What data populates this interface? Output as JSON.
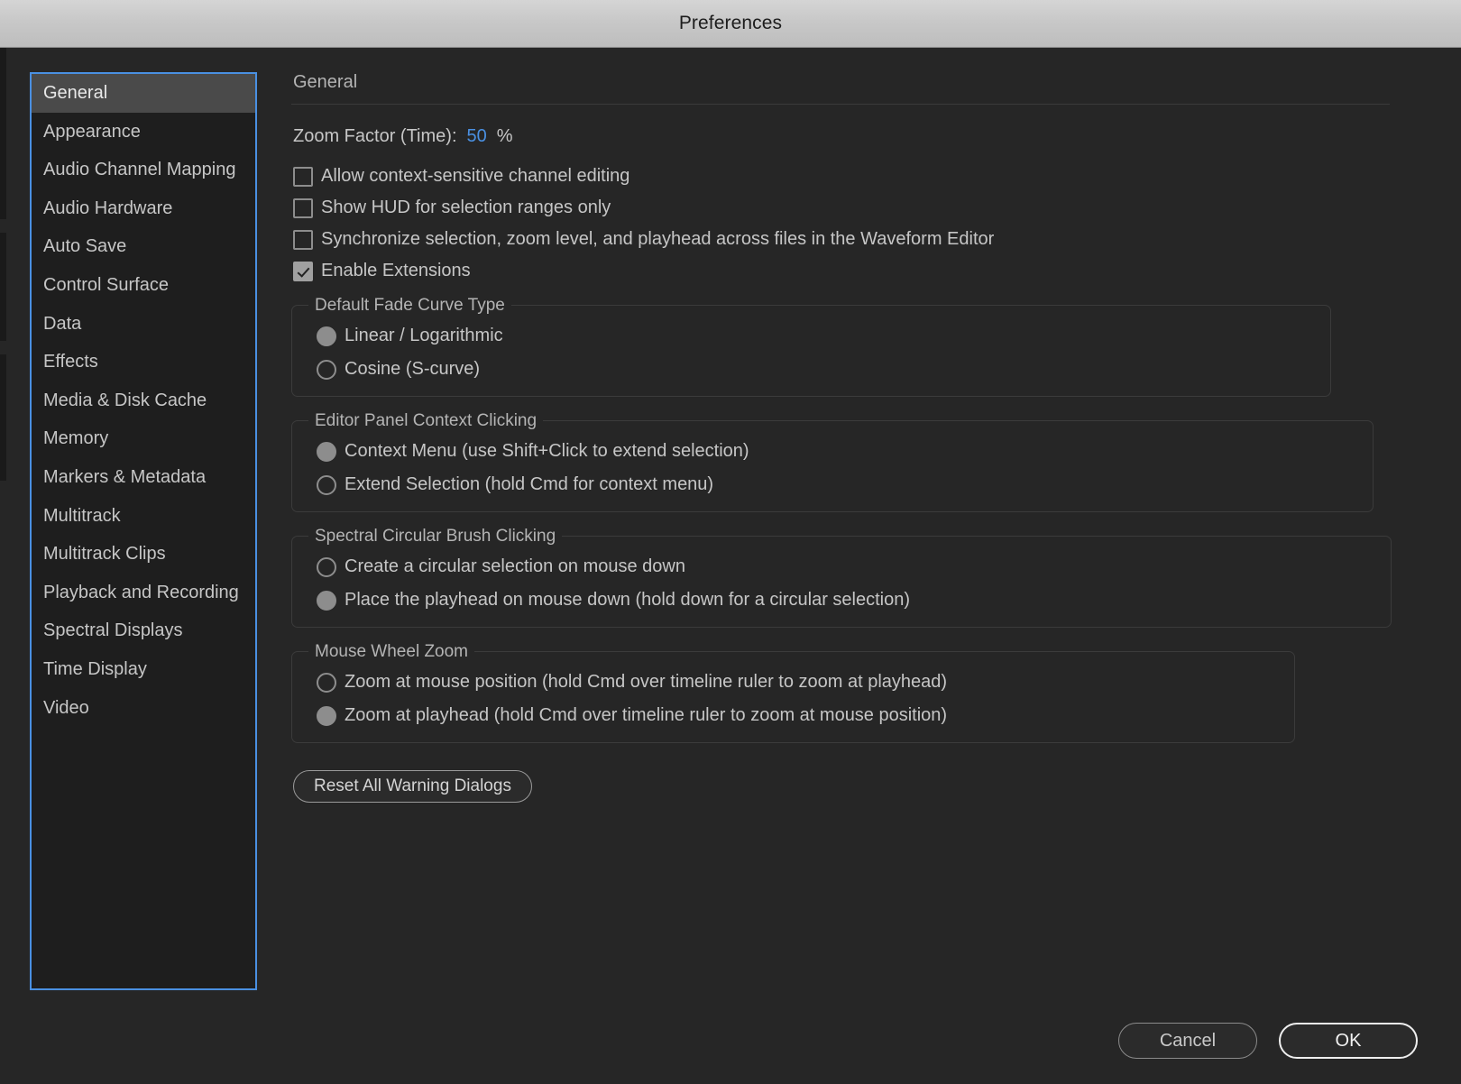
{
  "window": {
    "title": "Preferences"
  },
  "sidebar": {
    "items": [
      {
        "label": "General",
        "selected": true
      },
      {
        "label": "Appearance",
        "selected": false
      },
      {
        "label": "Audio Channel Mapping",
        "selected": false
      },
      {
        "label": "Audio Hardware",
        "selected": false
      },
      {
        "label": "Auto Save",
        "selected": false
      },
      {
        "label": "Control Surface",
        "selected": false
      },
      {
        "label": "Data",
        "selected": false
      },
      {
        "label": "Effects",
        "selected": false
      },
      {
        "label": "Media & Disk Cache",
        "selected": false
      },
      {
        "label": "Memory",
        "selected": false
      },
      {
        "label": "Markers & Metadata",
        "selected": false
      },
      {
        "label": "Multitrack",
        "selected": false
      },
      {
        "label": "Multitrack Clips",
        "selected": false
      },
      {
        "label": "Playback and Recording",
        "selected": false
      },
      {
        "label": "Spectral Displays",
        "selected": false
      },
      {
        "label": "Time Display",
        "selected": false
      },
      {
        "label": "Video",
        "selected": false
      }
    ]
  },
  "main": {
    "heading": "General",
    "zoom_factor": {
      "label": "Zoom Factor (Time):",
      "value": "50",
      "unit": "%"
    },
    "checkboxes": [
      {
        "label": "Allow context-sensitive channel editing",
        "checked": false
      },
      {
        "label": "Show HUD for selection ranges only",
        "checked": false
      },
      {
        "label": "Synchronize selection, zoom level, and playhead across files in the Waveform Editor",
        "checked": false
      },
      {
        "label": "Enable Extensions",
        "checked": true
      }
    ],
    "groups": [
      {
        "legend": "Default Fade Curve Type",
        "options": [
          {
            "label": "Linear / Logarithmic",
            "selected": true
          },
          {
            "label": "Cosine (S-curve)",
            "selected": false
          }
        ]
      },
      {
        "legend": "Editor Panel Context Clicking",
        "options": [
          {
            "label": "Context Menu (use Shift+Click to extend selection)",
            "selected": true
          },
          {
            "label": "Extend Selection (hold Cmd for context menu)",
            "selected": false
          }
        ]
      },
      {
        "legend": "Spectral Circular Brush Clicking",
        "options": [
          {
            "label": "Create a circular selection on mouse down",
            "selected": false
          },
          {
            "label": "Place the playhead on mouse down (hold down for a circular selection)",
            "selected": true
          }
        ]
      },
      {
        "legend": "Mouse Wheel Zoom",
        "options": [
          {
            "label": "Zoom at mouse position (hold Cmd over timeline ruler to zoom at playhead)",
            "selected": false
          },
          {
            "label": "Zoom at playhead (hold Cmd over timeline ruler to zoom at mouse position)",
            "selected": true
          }
        ]
      }
    ],
    "reset_button": "Reset All Warning Dialogs"
  },
  "footer": {
    "cancel": "Cancel",
    "ok": "OK"
  },
  "colors": {
    "accent_blue": "#4a90e2",
    "dialog_background": "#262626",
    "sidebar_background": "#1e1e1e",
    "selected_item_background": "#4a4a4a",
    "text_primary": "#c6c6c6",
    "titlebar_text": "#1d1d1d"
  }
}
